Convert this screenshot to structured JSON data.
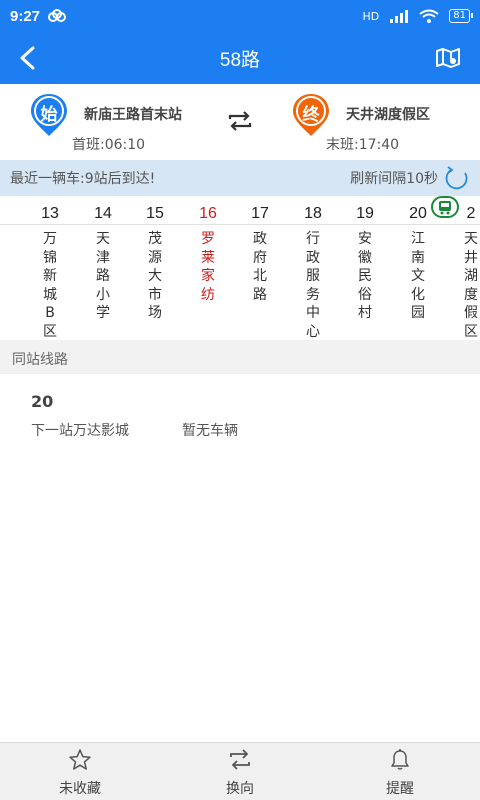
{
  "status_bar": {
    "time": "9:27",
    "network": "HD",
    "battery": "81"
  },
  "header": {
    "title": "58路"
  },
  "route": {
    "start": {
      "badge": "始",
      "name": "新庙王路首末站",
      "time_label": "首班:06:10",
      "color": "#1c7ef0"
    },
    "end": {
      "badge": "终",
      "name": "天井湖度假区",
      "time_label": "末班:17:40",
      "color": "#f0650a"
    }
  },
  "notice": {
    "left": "最近一辆车:9站后到达!",
    "right": "刷新间隔10秒"
  },
  "stations": [
    {
      "num": "13",
      "name": "万锦新城B区",
      "current": false
    },
    {
      "num": "14",
      "name": "天津路小学",
      "current": false
    },
    {
      "num": "15",
      "name": "茂源大市场",
      "current": false
    },
    {
      "num": "16",
      "name": "罗莱家纺",
      "current": true
    },
    {
      "num": "17",
      "name": "政府北路",
      "current": false
    },
    {
      "num": "18",
      "name": "行政服务中心",
      "current": false
    },
    {
      "num": "19",
      "name": "安徽民俗村",
      "current": false
    },
    {
      "num": "20",
      "name": "江南文化园",
      "current": false
    },
    {
      "num": "2",
      "name": "天井湖度假区",
      "current": false
    }
  ],
  "same_station": {
    "header": "同站线路",
    "lines": [
      {
        "num": "20",
        "next": "下一站万达影城",
        "status": "暂无车辆"
      }
    ]
  },
  "bottom_nav": [
    {
      "label": "未收藏",
      "icon": "star-icon"
    },
    {
      "label": "换向",
      "icon": "swap-icon"
    },
    {
      "label": "提醒",
      "icon": "bell-icon"
    }
  ],
  "colors": {
    "primary": "#1c7ef0",
    "current_station": "#d21a1a",
    "bus_marker": "#1a8a3a"
  }
}
